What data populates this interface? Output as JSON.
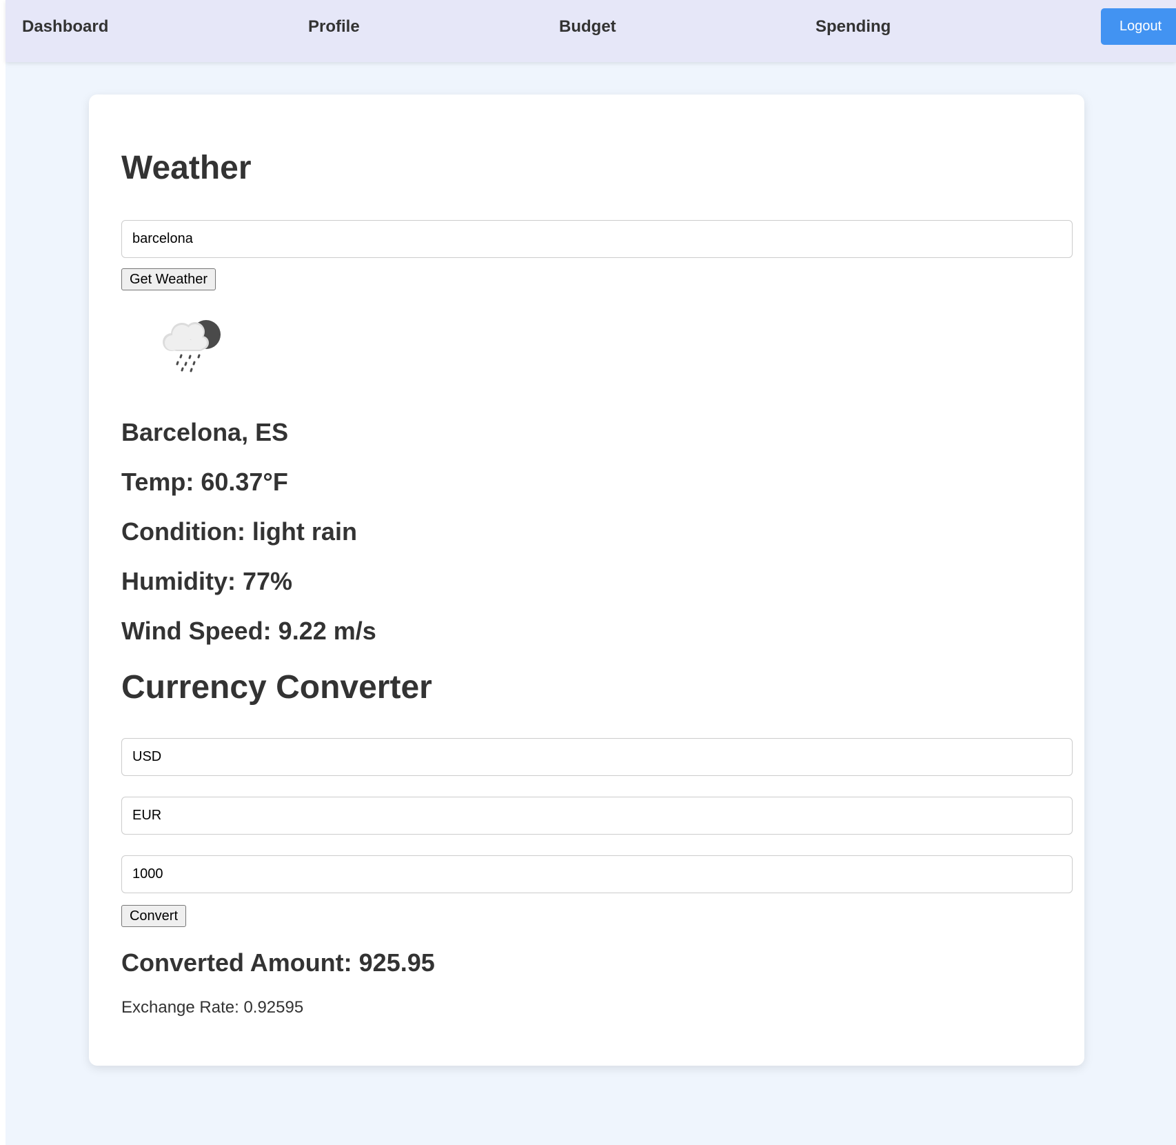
{
  "nav": {
    "links": [
      {
        "label": "Dashboard"
      },
      {
        "label": "Profile"
      },
      {
        "label": "Budget"
      },
      {
        "label": "Spending"
      }
    ],
    "logout_label": "Logout"
  },
  "weather": {
    "title": "Weather",
    "city_input_value": "barcelona",
    "button_label": "Get Weather",
    "icon": "rain-cloud-moon-icon",
    "location": "Barcelona, ES",
    "temp": "Temp: 60.37°F",
    "condition": "Condition: light rain",
    "humidity": "Humidity: 77%",
    "wind_speed": "Wind Speed: 9.22 m/s"
  },
  "currency": {
    "title": "Currency Converter",
    "from_value": "USD",
    "to_value": "EUR",
    "amount_value": "1000",
    "button_label": "Convert",
    "converted_amount": "Converted Amount: 925.95",
    "exchange_rate": "Exchange Rate: 0.92595"
  },
  "colors": {
    "page_background": "#eff5fd",
    "navbar_background": "#e6e7f8",
    "logout_button": "#4293f2",
    "card_background": "#ffffff",
    "text": "#333333"
  }
}
